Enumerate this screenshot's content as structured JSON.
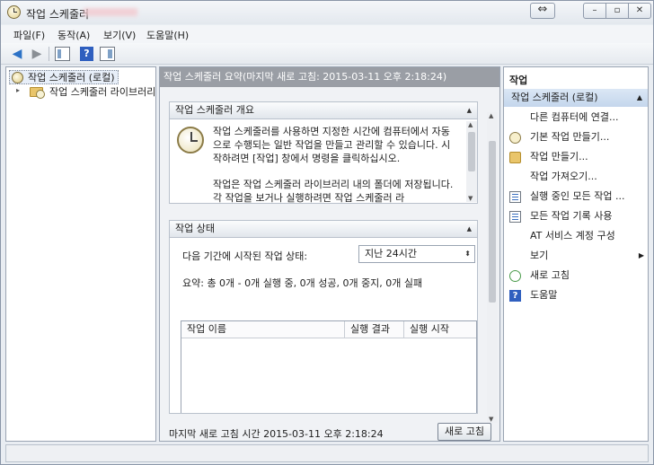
{
  "window": {
    "title": "작업 스케줄러"
  },
  "menu": [
    "파일(F)",
    "동작(A)",
    "보기(V)",
    "도움말(H)"
  ],
  "toolbar": {
    "help_glyph": "?"
  },
  "tree": {
    "root": "작업 스케줄러 (로컬)",
    "child": "작업 스케줄러 라이브러리"
  },
  "center": {
    "header": "작업 스케줄러 요약(마지막 새로 고침: 2015-03-11 오후 2:18:24)",
    "overview": {
      "title": "작업 스케줄러 개요",
      "para1": "작업 스케줄러를 사용하면 지정한 시간에 컴퓨터에서 자동으로 수행되는 일반 작업을 만들고 관리할 수 있습니다. 시작하려면 [작업] 창에서 명령을 클릭하십시오.",
      "para2": "작업은 작업 스케줄러 라이브러리 내의 폴더에 저장됩니다. 각 작업을 보거나 실행하려면 작업 스케줄러 라"
    },
    "status": {
      "title": "작업 상태",
      "label": "다음 기간에 시작된 작업 상태:",
      "period": "지난 24시간",
      "summary": "요약: 총 0개 - 0개 실행 중, 0개 성공, 0개 중지, 0개 실패",
      "columns": [
        "작업 이름",
        "실행 결과",
        "실행 시작"
      ]
    },
    "footer": {
      "last_refresh": "마지막 새로 고침 시간 2015-03-11 오후 2:18:24",
      "refresh_button": "새로 고침"
    }
  },
  "actions": {
    "title": "작업",
    "group": "작업 스케줄러 (로컬)",
    "items": [
      {
        "label": "다른 컴퓨터에 연결...",
        "icon": "none"
      },
      {
        "label": "기본 작업 만들기...",
        "icon": "basic-task-icon"
      },
      {
        "label": "작업 만들기...",
        "icon": "task-icon"
      },
      {
        "label": "작업 가져오기...",
        "icon": "none"
      },
      {
        "label": "실행 중인 모든 작업 ...",
        "icon": "running-tasks-icon"
      },
      {
        "label": "모든 작업 기록 사용",
        "icon": "history-icon"
      },
      {
        "label": "AT 서비스 계정 구성",
        "icon": "none"
      },
      {
        "label": "보기",
        "icon": "none",
        "submenu": true
      },
      {
        "label": "새로 고침",
        "icon": "refresh-icon"
      },
      {
        "label": "도움말",
        "icon": "help-icon"
      }
    ]
  }
}
